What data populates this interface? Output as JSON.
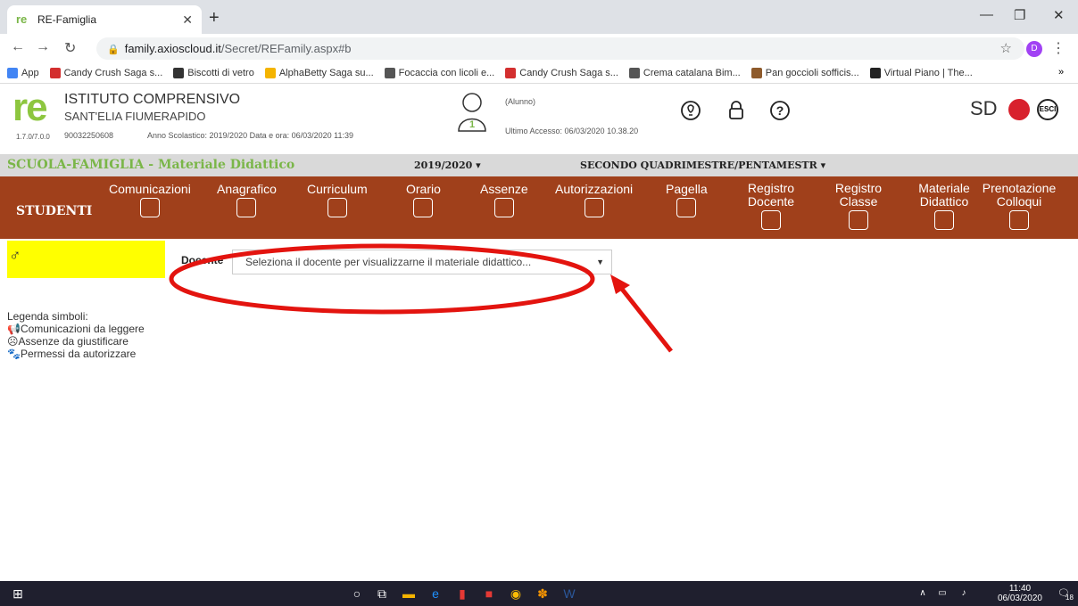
{
  "browser": {
    "tab_title": "RE-Famiglia",
    "url_host": "family.axioscloud.it",
    "url_path": "/Secret/REFamily.aspx#b",
    "profile_initial": "D",
    "bookmarks": [
      {
        "label": "App",
        "color": "#4285f4"
      },
      {
        "label": "Candy Crush Saga s...",
        "color": "#d32f2f"
      },
      {
        "label": "Biscotti di vetro",
        "color": "#333333"
      },
      {
        "label": "AlphaBetty Saga su...",
        "color": "#f4b400"
      },
      {
        "label": "Focaccia con licoli e...",
        "color": "#555555"
      },
      {
        "label": "Candy Crush Saga s...",
        "color": "#d32f2f"
      },
      {
        "label": "Crema catalana Bim...",
        "color": "#555555"
      },
      {
        "label": "Pan goccioli sofficis...",
        "color": "#8e5a2b"
      },
      {
        "label": "Virtual Piano | The...",
        "color": "#222222"
      }
    ]
  },
  "header": {
    "version": "1.7.0/7.0.0",
    "school_name": "ISTITUTO COMPRENSIVO",
    "school_sub": "SANT'ELIA FIUMERAPIDO",
    "code": "90032250608",
    "year_info": "Anno Scolastico: 2019/2020   Data e ora: 06/03/2020 11:39",
    "alunno": "(Alunno)",
    "last_access": "Ultimo Accesso: 06/03/2020 10.38.20",
    "avatar_badge": "1",
    "sd_logo": "SD",
    "exit": "ESCI"
  },
  "section": {
    "title": "SCUOLA-FAMIGLIA - Materiale Didattico",
    "year": "2019/2020 ▾",
    "period": "SECONDO QUADRIMESTRE/PENTAMESTR ▾"
  },
  "nav": {
    "studenti": "STUDENTI",
    "items": [
      "Comunicazioni",
      "Anagrafico",
      "Curriculum",
      "Orario",
      "Assenze",
      "Autorizzazioni",
      "Pagella",
      "Registro Docente",
      "Registro Classe",
      "Materiale Didattico",
      "Prenotazione Colloqui"
    ]
  },
  "content": {
    "gender_symbol": "♂",
    "docente_label": "Docente",
    "docente_placeholder": "Seleziona il docente per visualizzarne il materiale didattico..."
  },
  "legend": {
    "title": "Legenda simboli:",
    "items": [
      "Comunicazioni da leggere",
      "Assenze da giustificare",
      "Permessi da autorizzare"
    ]
  },
  "taskbar": {
    "time": "11:40",
    "date": "06/03/2020",
    "notif": "18"
  },
  "colors": {
    "nav_bg": "#a0401b",
    "accent_green": "#7ab648",
    "highlight_yellow": "#ffff00",
    "annotation_red": "#e3140f"
  }
}
